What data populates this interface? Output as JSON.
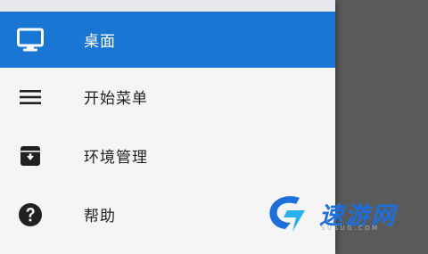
{
  "drawer": {
    "items": [
      {
        "label": "桌面",
        "icon": "monitor-icon",
        "active": true
      },
      {
        "label": "开始菜单",
        "icon": "menu-icon",
        "active": false
      },
      {
        "label": "环境管理",
        "icon": "archive-icon",
        "active": false
      },
      {
        "label": "帮助",
        "icon": "help-icon",
        "active": false
      }
    ]
  },
  "watermark": {
    "title": "速游网",
    "subtitle": "SUSUG.COM"
  },
  "colors": {
    "accent": "#1976d2",
    "drawer_bg": "#f5f5f5",
    "scrim": "#5a5a5a",
    "watermark_blue": "#1e6fd9"
  }
}
